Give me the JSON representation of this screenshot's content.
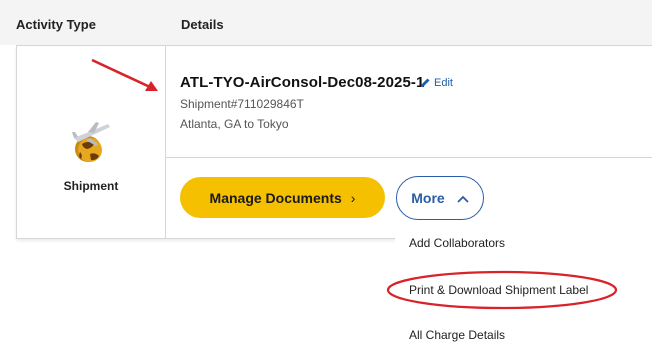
{
  "header": {
    "activity_type": "Activity Type",
    "details": "Details"
  },
  "activity": {
    "type_label": "Shipment",
    "type_icon": "shipment-globe-plane-icon"
  },
  "shipment": {
    "title": "ATL-TYO-AirConsol-Dec08-2025-1",
    "edit_label": "Edit",
    "shipment_number": "Shipment#711029846T",
    "route": "Atlanta, GA to Tokyo"
  },
  "actions": {
    "manage_documents": "Manage Documents",
    "more": "More"
  },
  "more_menu": {
    "items": [
      "Add Collaborators",
      "Print & Download Shipment Label",
      "All Charge Details"
    ]
  },
  "colors": {
    "primary_button": "#f5c000",
    "link_blue": "#2a5da8",
    "annotation_red": "#d8232a"
  }
}
